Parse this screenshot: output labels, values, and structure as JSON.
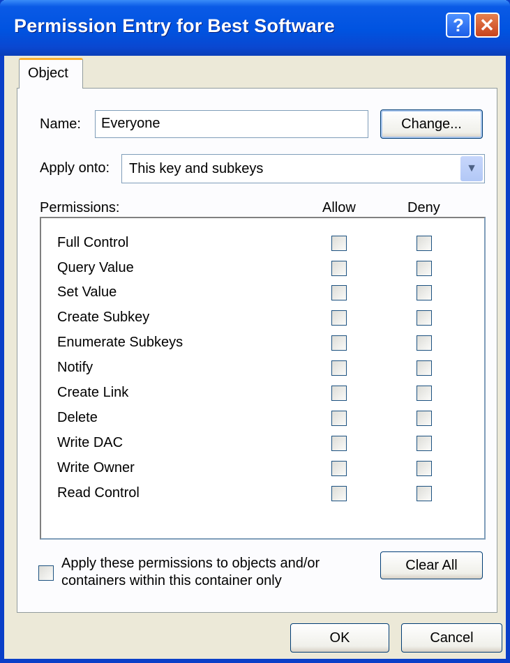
{
  "window": {
    "title": "Permission Entry for Best Software",
    "help_glyph": "?",
    "close_glyph": "✕"
  },
  "tabs": [
    {
      "label": "Object"
    }
  ],
  "name_field": {
    "label": "Name:",
    "value": "Everyone",
    "change_label": "Change..."
  },
  "apply_onto": {
    "label": "Apply onto:",
    "value": "This key and subkeys",
    "arrow_glyph": "▼"
  },
  "permissions": {
    "header_label": "Permissions:",
    "allow_label": "Allow",
    "deny_label": "Deny",
    "rows": [
      {
        "name": "Full Control",
        "allow": false,
        "deny": false
      },
      {
        "name": "Query Value",
        "allow": false,
        "deny": false
      },
      {
        "name": "Set Value",
        "allow": false,
        "deny": false
      },
      {
        "name": "Create Subkey",
        "allow": false,
        "deny": false
      },
      {
        "name": "Enumerate Subkeys",
        "allow": false,
        "deny": false
      },
      {
        "name": "Notify",
        "allow": false,
        "deny": false
      },
      {
        "name": "Create Link",
        "allow": false,
        "deny": false
      },
      {
        "name": "Delete",
        "allow": false,
        "deny": false
      },
      {
        "name": "Write DAC",
        "allow": false,
        "deny": false
      },
      {
        "name": "Write Owner",
        "allow": false,
        "deny": false
      },
      {
        "name": "Read Control",
        "allow": false,
        "deny": false
      }
    ]
  },
  "apply_within": {
    "label": "Apply these permissions to objects and/or containers within this container only",
    "checked": false
  },
  "buttons": {
    "clear_all": "Clear All",
    "ok": "OK",
    "cancel": "Cancel"
  },
  "colors": {
    "titlebar": "#0053e0",
    "window_border": "#0a3fc8",
    "tab_accent": "#f9b030",
    "face": "#ece9d8"
  }
}
